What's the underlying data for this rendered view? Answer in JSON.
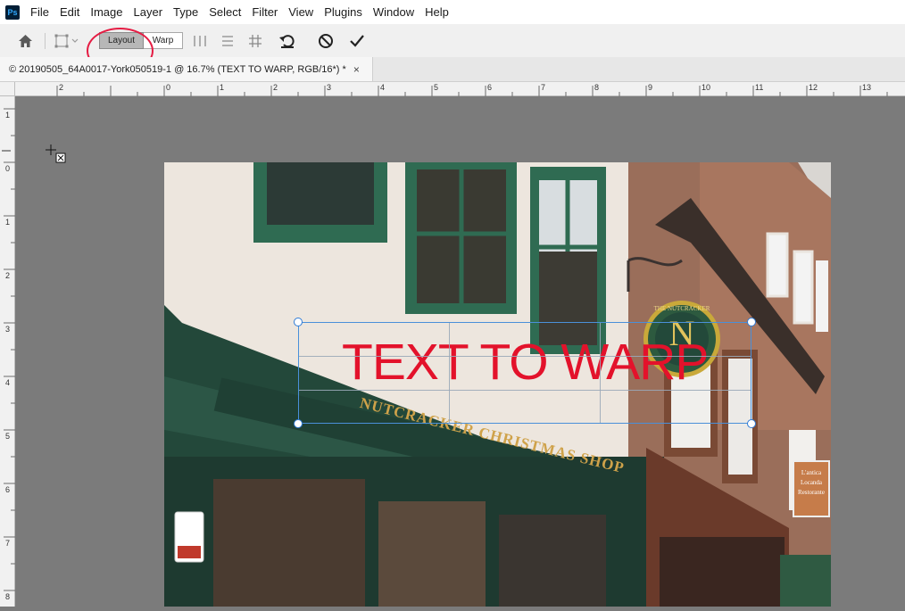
{
  "app": {
    "logo": "Ps",
    "menu": [
      "File",
      "Edit",
      "Image",
      "Layer",
      "Type",
      "Select",
      "Filter",
      "View",
      "Plugins",
      "Window",
      "Help"
    ]
  },
  "options": {
    "layout_label": "Layout",
    "warp_label": "Warp",
    "icons": [
      "home-icon",
      "transform-icon",
      "split-vertical-icon",
      "split-horizontal-icon",
      "grid-icon",
      "reset-icon",
      "cancel-icon",
      "commit-icon"
    ]
  },
  "document": {
    "tab_title": "© 20190505_64A0017-York050519-1 @ 16.7% (TEXT TO WARP, RGB/16*) *",
    "close_glyph": "×"
  },
  "rulers": {
    "h_labels": [
      "2",
      "0",
      "1",
      "2",
      "3",
      "4",
      "5",
      "6",
      "7",
      "8",
      "9",
      "10",
      "11",
      "12",
      "13"
    ],
    "v_labels": [
      "1",
      "0",
      "1",
      "2",
      "3",
      "4",
      "5",
      "6",
      "7",
      "8"
    ]
  },
  "canvas": {
    "warp_text": "TEXT TO WARP",
    "shop_sign": "NUTCRACKER CHRISTMAS SHOP",
    "badge_text": "THE NUTCRACKER",
    "badge_letter": "N",
    "side_sign": "L'antica Locanda Restorante",
    "text_color": "#e3122b",
    "box_color": "#4a90d9"
  },
  "colors": {
    "highlight": "#e51c43",
    "canvas_bg": "#7b7b7b"
  }
}
